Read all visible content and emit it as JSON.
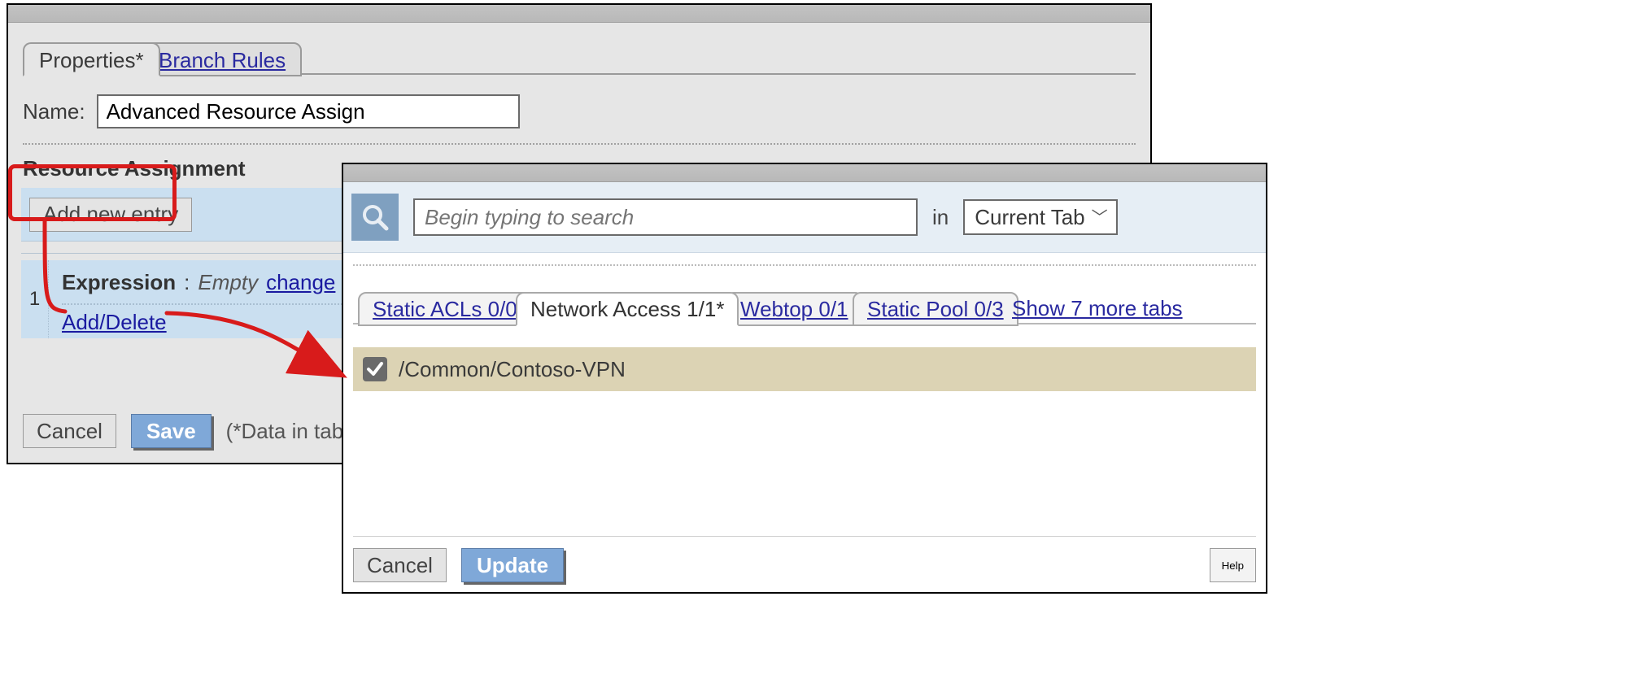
{
  "back": {
    "tabs": {
      "active": "Properties*",
      "other": "Branch Rules"
    },
    "name_label": "Name:",
    "name_value": "Advanced Resource Assign",
    "ra_heading": "Resource Assignment",
    "add_entry_label": "Add new entry",
    "entry": {
      "index": "1",
      "expression_label": "Expression",
      "colon": ":",
      "expression_value": "Empty",
      "change_link": "change",
      "add_delete_link": "Add/Delete"
    },
    "footer": {
      "cancel": "Cancel",
      "save": "Save",
      "note": "(*Data in tab has"
    }
  },
  "front": {
    "search": {
      "placeholder": "Begin typing to search",
      "in_label": "in",
      "scope": "Current Tab"
    },
    "tabs": [
      {
        "label": "Static ACLs 0/0",
        "active": false
      },
      {
        "label": "Network Access 1/1*",
        "active": true
      },
      {
        "label": "Webtop 0/1",
        "active": false
      },
      {
        "label": "Static Pool 0/3",
        "active": false
      }
    ],
    "more_tabs": "Show 7 more tabs",
    "item": {
      "checked": true,
      "name": "/Common/Contoso-VPN"
    },
    "footer": {
      "cancel": "Cancel",
      "update": "Update",
      "help": "Help"
    }
  }
}
